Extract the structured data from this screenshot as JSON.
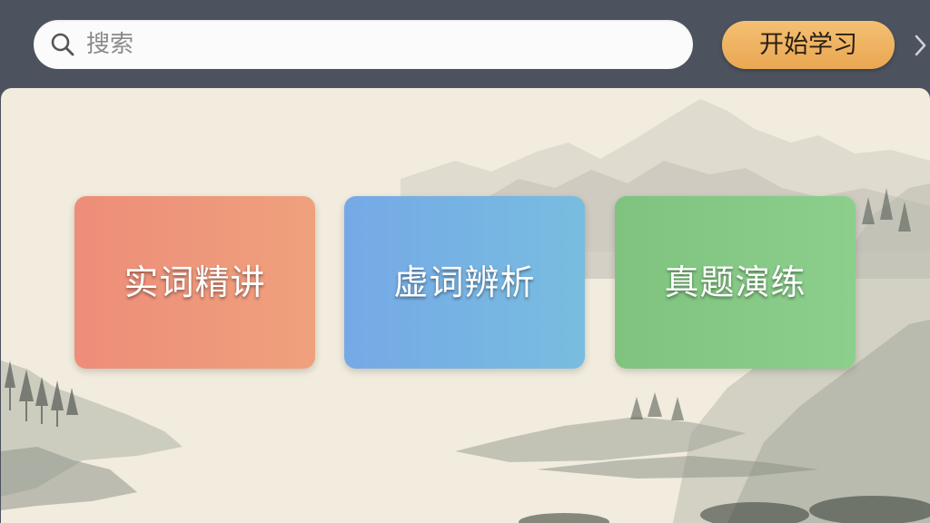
{
  "header": {
    "search": {
      "placeholder": "搜索",
      "icon": "search-icon"
    },
    "start_button": {
      "label": "开始学习",
      "color": "#f0b563"
    },
    "next_icon": "chevron-right-icon"
  },
  "main": {
    "background": "ink-landscape-painting",
    "cards": [
      {
        "label": "实词精讲",
        "color": "#ee927a"
      },
      {
        "label": "虚词辨析",
        "color": "#76b2e3"
      },
      {
        "label": "真题演练",
        "color": "#85c985"
      }
    ]
  }
}
